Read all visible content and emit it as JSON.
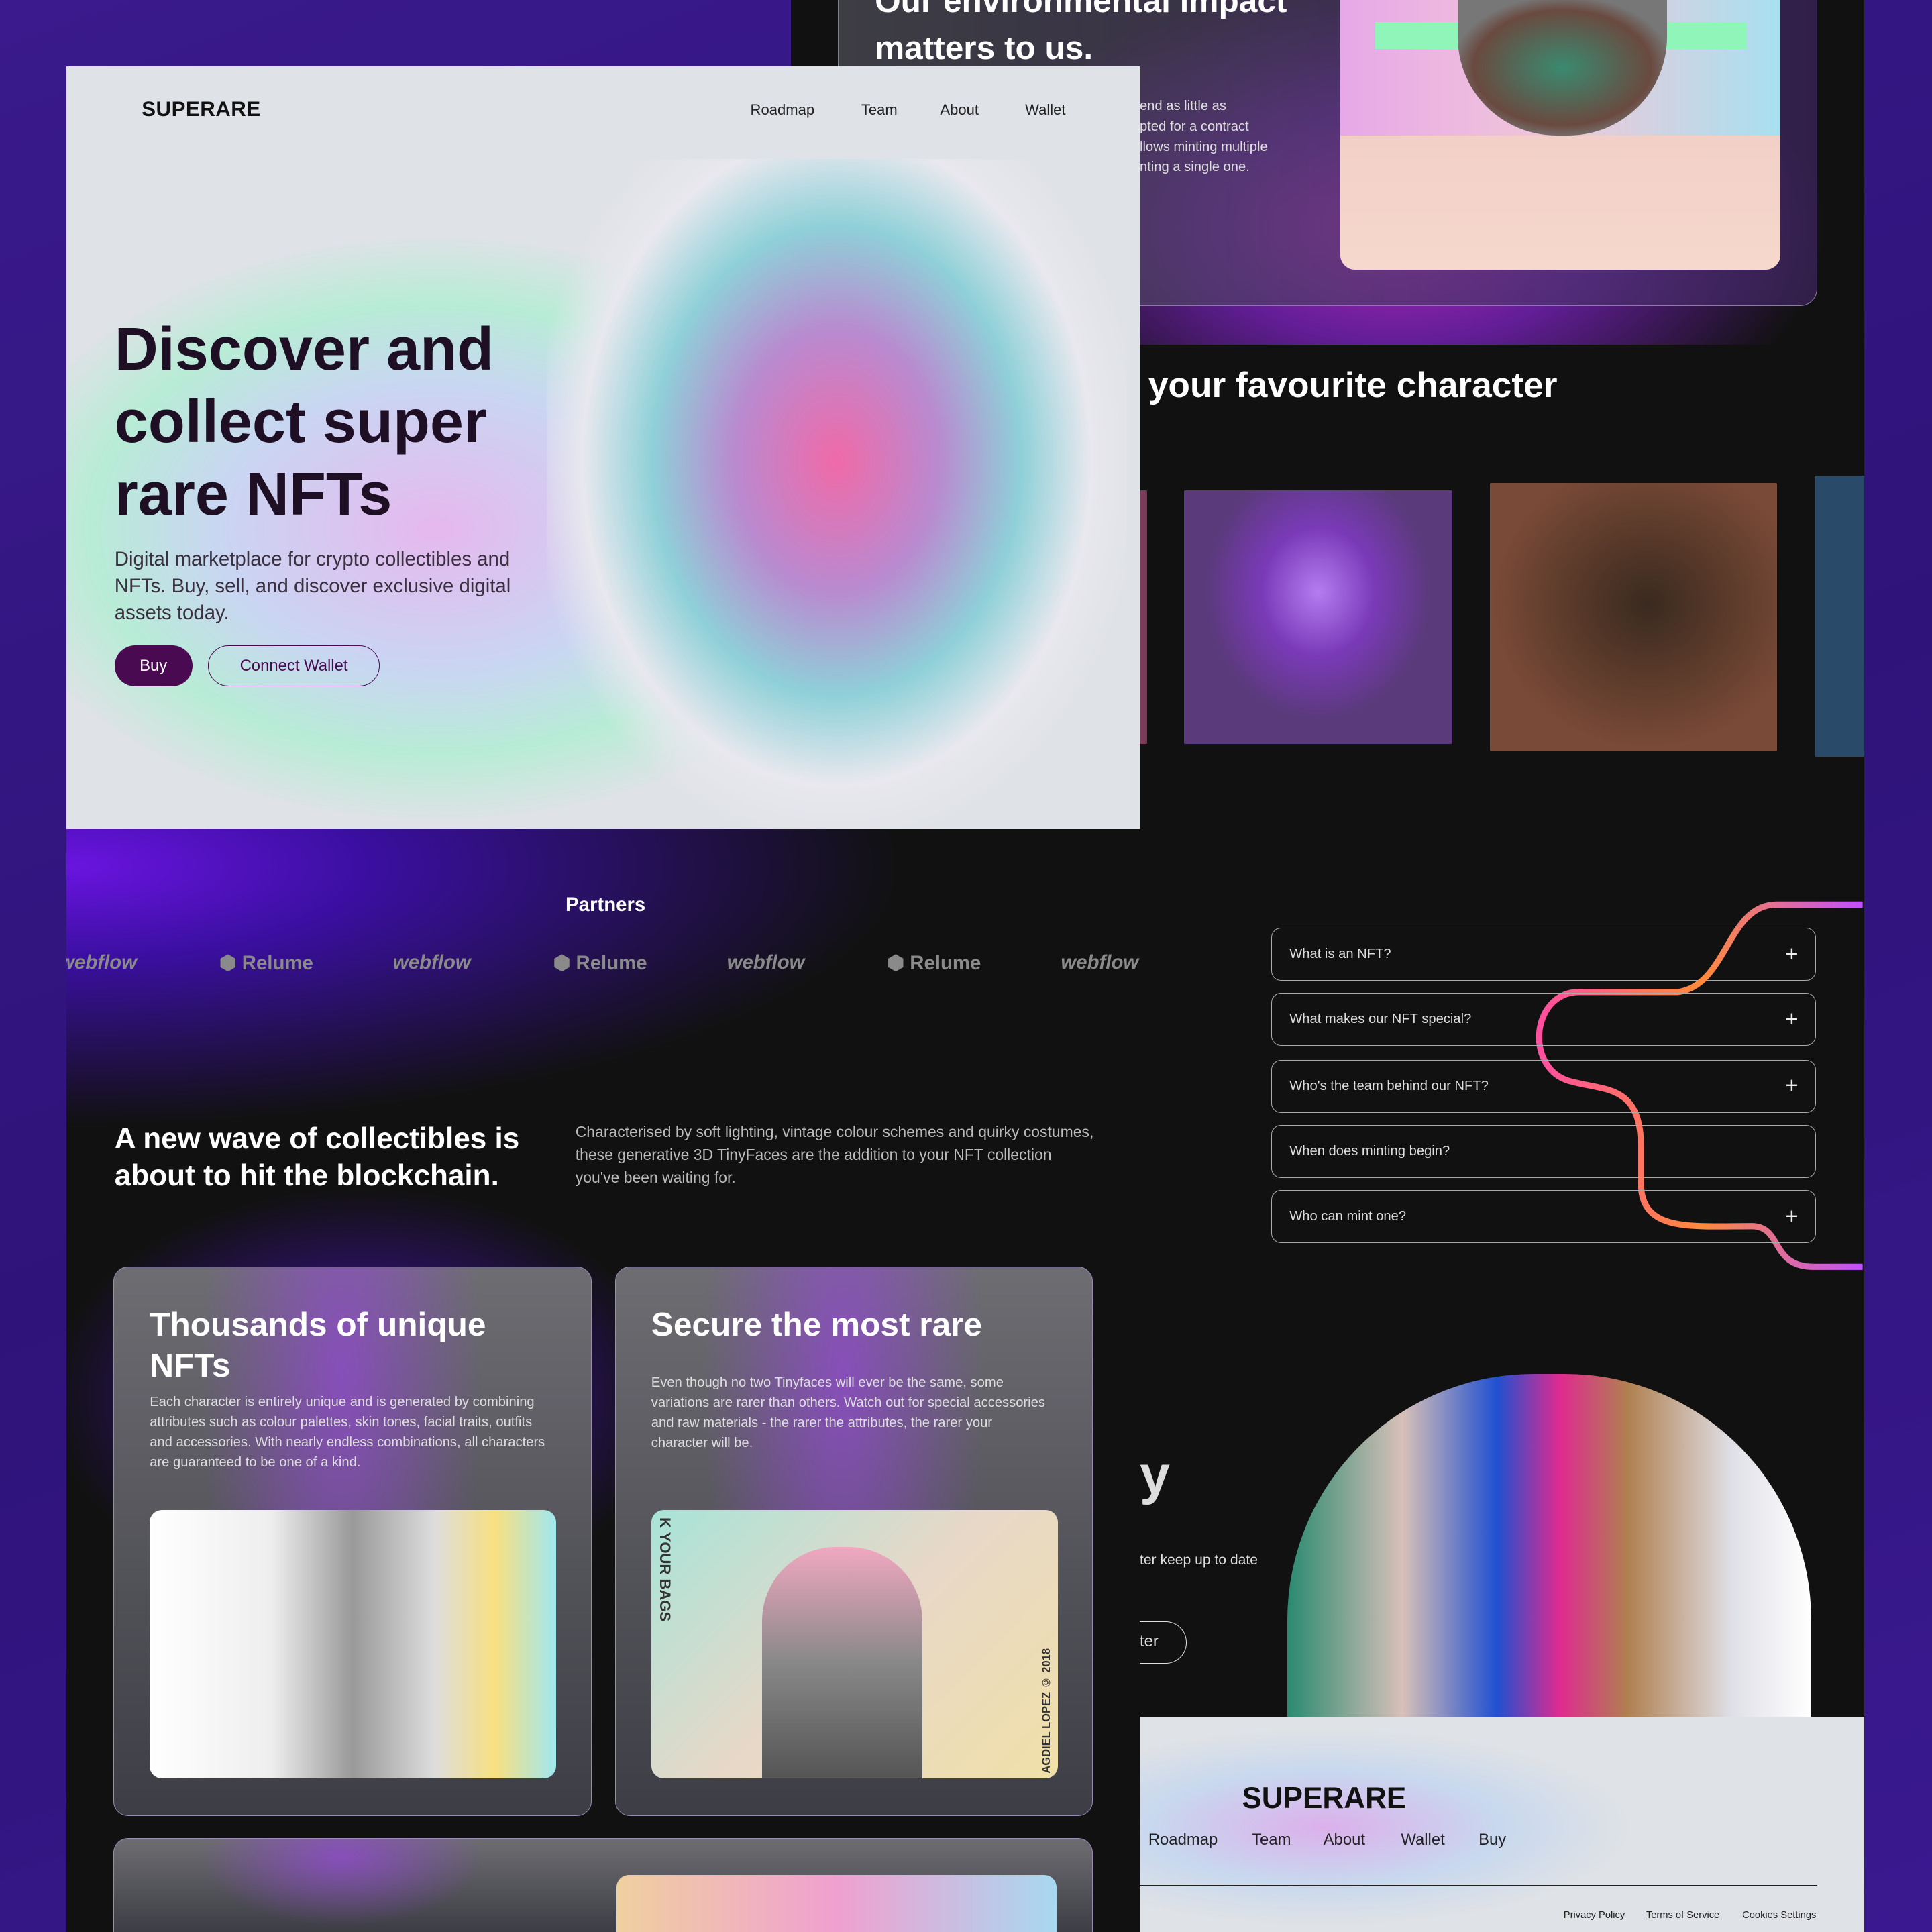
{
  "brand": "SUPERARE",
  "nav": [
    "Roadmap",
    "Team",
    "About",
    "Wallet"
  ],
  "hero": {
    "title": "Discover and collect super rare NFTs",
    "subtitle": "Digital marketplace for crypto collectibles and NFTs. Buy, sell, and discover exclusive digital assets today.",
    "buy": "Buy",
    "connect": "Connect Wallet"
  },
  "partners": {
    "title": "Partners",
    "logos": [
      "webflow",
      "Relume",
      "webflow",
      "Relume",
      "webflow",
      "Relume",
      "webflow"
    ]
  },
  "intro": {
    "title": "A new wave of collectibles is about to hit the blockchain.",
    "text": "Characterised by soft lighting, vintage colour schemes and quirky costumes, these generative 3D TinyFaces are the addition to your NFT collection you've been waiting for."
  },
  "cards": [
    {
      "title": "Thousands of unique NFTs",
      "text": "Each character is entirely unique and is generated by combining attributes such as colour palettes, skin tones, facial traits, outfits and accessories. With nearly endless combinations, all characters are guaranteed to be one of a kind."
    },
    {
      "title": "Secure the most rare",
      "text": "Even though no two Tinyfaces will ever be the same, some variations are rarer than others. Watch out for special accessories and raw materials - the rarer the attributes, the rarer your character will be.",
      "poster_left": "K YOUR BAGS",
      "poster_right": "AGDIEL LOPEZ © 2018"
    }
  ],
  "environment": {
    "title": "Our environmental impact matters to us.",
    "text_fragment": "end as little as\npted for a contract\nllows minting multiple\nnting a single one."
  },
  "characters": {
    "title": "your favourite character"
  },
  "faq": [
    {
      "q": "What is an NFT?",
      "icon": "+"
    },
    {
      "q": "What makes our NFT special?",
      "icon": "+"
    },
    {
      "q": "Who's the team behind our NFT?",
      "icon": "+"
    },
    {
      "q": "When does minting begin?",
      "icon": ""
    },
    {
      "q": "Who can mint one?",
      "icon": "+"
    }
  ],
  "cta": {
    "title_fragment": "y",
    "text_fragment": "ter keep up to date",
    "button_fragment": "ter"
  },
  "footer": {
    "brand": "SUPERARE",
    "nav": [
      "Roadmap",
      "Team",
      "About",
      "Wallet",
      "Buy"
    ],
    "legal": [
      "Privacy Policy",
      "Terms of Service",
      "Cookies Settings"
    ]
  }
}
